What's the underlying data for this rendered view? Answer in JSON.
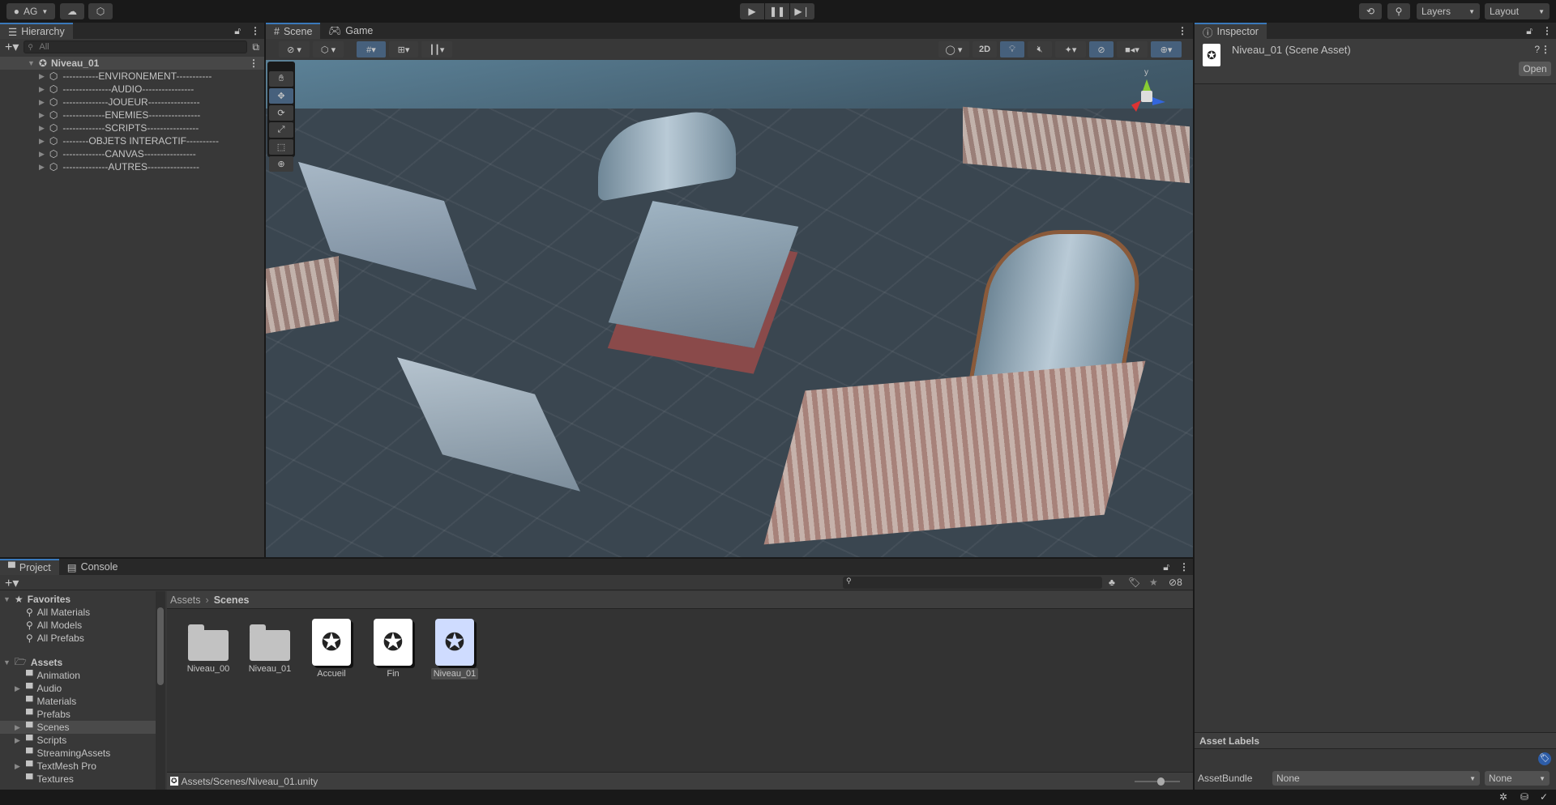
{
  "topbar": {
    "account": "AG",
    "layers": "Layers",
    "layout": "Layout"
  },
  "hierarchy": {
    "tab": "Hierarchy",
    "search_placeholder": "All",
    "scene": "Niveau_01",
    "items": [
      "-----------ENVIRONEMENT-----------",
      "---------------AUDIO----------------",
      "--------------JOUEUR----------------",
      "-------------ENEMIES----------------",
      "-------------SCRIPTS----------------",
      "--------OBJETS INTERACTIF----------",
      "-------------CANVAS----------------",
      "--------------AUTRES----------------"
    ]
  },
  "scene": {
    "tabs": [
      "Scene",
      "Game"
    ],
    "mode2d": "2D",
    "gizmo_axis": "y"
  },
  "inspector": {
    "tab": "Inspector",
    "title": "Niveau_01 (Scene Asset)",
    "open": "Open",
    "asset_labels": "Asset Labels",
    "asset_bundle": "AssetBundle",
    "bundle_value": "None",
    "variant_value": "None"
  },
  "project": {
    "tabs": [
      "Project",
      "Console"
    ],
    "hidden_count": "8",
    "favorites": {
      "label": "Favorites",
      "items": [
        "All Materials",
        "All Models",
        "All Prefabs"
      ]
    },
    "assets": {
      "label": "Assets",
      "items": [
        {
          "name": "Animation",
          "expandable": false
        },
        {
          "name": "Audio",
          "expandable": true
        },
        {
          "name": "Materials",
          "expandable": false
        },
        {
          "name": "Prefabs",
          "expandable": false
        },
        {
          "name": "Scenes",
          "expandable": true,
          "selected": true
        },
        {
          "name": "Scripts",
          "expandable": true
        },
        {
          "name": "StreamingAssets",
          "expandable": false
        },
        {
          "name": "TextMesh Pro",
          "expandable": true
        },
        {
          "name": "Textures",
          "expandable": false
        }
      ]
    },
    "breadcrumb": [
      "Assets",
      "Scenes"
    ],
    "files": [
      {
        "name": "Niveau_00",
        "type": "folder"
      },
      {
        "name": "Niveau_01",
        "type": "folder"
      },
      {
        "name": "Accueil",
        "type": "scene"
      },
      {
        "name": "Fin",
        "type": "scene"
      },
      {
        "name": "Niveau_01",
        "type": "scene",
        "selected": true
      }
    ],
    "path": "Assets/Scenes/Niveau_01.unity"
  },
  "colors": {
    "accent": "#3a79bb",
    "panel": "#383838",
    "dark": "#191919"
  }
}
